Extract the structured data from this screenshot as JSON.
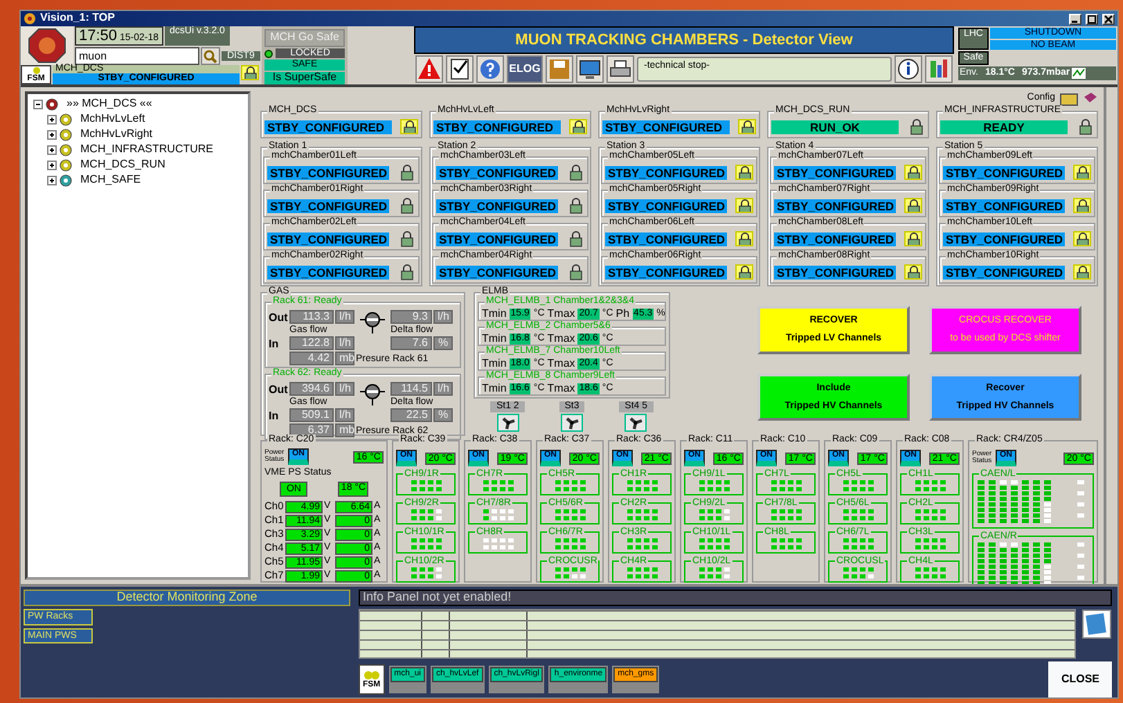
{
  "window": {
    "title": "Vision_1: TOP"
  },
  "header": {
    "clock": "17:50",
    "date": "15-02-18",
    "version": "dcsUi v.3.2.0",
    "search": "muon",
    "dist": "DIST9",
    "fsm": "FSM",
    "node": "MCH_DCS",
    "node_state": "STBY_CONFIGURED"
  },
  "safety": {
    "go_safe": "MCH Go Safe",
    "locked": "LOCKED",
    "safe": "SAFE",
    "supersafe": "Is SuperSafe"
  },
  "title": "MUON TRACKING CHAMBERS - Detector View",
  "toolbar": {
    "elog": "ELOG",
    "message": "-technical stop-"
  },
  "lhc": {
    "label": "LHC",
    "states": [
      "SHUTDOWN",
      "NO BEAM"
    ],
    "safe": "Safe",
    "env": "Env.",
    "temperature": "18.1°C",
    "pressure": "973.7mbar"
  },
  "tree": {
    "label": "»» MCH_DCS ««",
    "expanded": true,
    "children": [
      {
        "label": "MchHvLvLeft",
        "kind": "node",
        "expanded": false
      },
      {
        "label": "MchHvLvRight",
        "kind": "node",
        "expanded": false
      },
      {
        "label": "MCH_INFRASTRUCTURE",
        "kind": "node",
        "expanded": false
      },
      {
        "label": "MCH_DCS_RUN",
        "kind": "node",
        "expanded": false
      },
      {
        "label": "MCH_SAFE",
        "kind": "safe",
        "expanded": false
      }
    ]
  },
  "config": "Config",
  "top_nodes": [
    {
      "label": "MCH_DCS",
      "state": "STBY_CONFIGURED",
      "kind": "standby",
      "lock_highlighted": true
    },
    {
      "label": "MchHvLvLeft",
      "state": "STBY_CONFIGURED",
      "kind": "standby",
      "lock_highlighted": true
    },
    {
      "label": "MchHvLvRight",
      "state": "STBY_CONFIGURED",
      "kind": "standby",
      "lock_highlighted": true
    },
    {
      "label": "MCH_DCS_RUN",
      "state": "RUN_OK",
      "kind": "ok",
      "lock_highlighted": false
    },
    {
      "label": "MCH_INFRASTRUCTURE",
      "state": "READY",
      "kind": "ok",
      "lock_highlighted": false
    }
  ],
  "stations": [
    {
      "title": "Station 1",
      "chambers": [
        {
          "name": "mchChamber01Left",
          "state": "STBY_CONFIGURED",
          "lock_highlighted": false
        },
        {
          "name": "mchChamber01Right",
          "state": "STBY_CONFIGURED",
          "lock_highlighted": false
        },
        {
          "name": "mchChamber02Left",
          "state": "STBY_CONFIGURED",
          "lock_highlighted": false
        },
        {
          "name": "mchChamber02Right",
          "state": "STBY_CONFIGURED",
          "lock_highlighted": false
        }
      ]
    },
    {
      "title": "Station 2",
      "chambers": [
        {
          "name": "mchChamber03Left",
          "state": "STBY_CONFIGURED",
          "lock_highlighted": false
        },
        {
          "name": "mchChamber03Right",
          "state": "STBY_CONFIGURED",
          "lock_highlighted": false
        },
        {
          "name": "mchChamber04Left",
          "state": "STBY_CONFIGURED",
          "lock_highlighted": false
        },
        {
          "name": "mchChamber04Right",
          "state": "STBY_CONFIGURED",
          "lock_highlighted": false
        }
      ]
    },
    {
      "title": "Station 3",
      "chambers": [
        {
          "name": "mchChamber05Left",
          "state": "STBY_CONFIGURED",
          "lock_highlighted": true
        },
        {
          "name": "mchChamber05Right",
          "state": "STBY_CONFIGURED",
          "lock_highlighted": true
        },
        {
          "name": "mchChamber06Left",
          "state": "STBY_CONFIGURED",
          "lock_highlighted": true
        },
        {
          "name": "mchChamber06Right",
          "state": "STBY_CONFIGURED",
          "lock_highlighted": true
        }
      ]
    },
    {
      "title": "Station 4",
      "chambers": [
        {
          "name": "mchChamber07Left",
          "state": "STBY_CONFIGURED",
          "lock_highlighted": true
        },
        {
          "name": "mchChamber07Right",
          "state": "STBY_CONFIGURED",
          "lock_highlighted": true
        },
        {
          "name": "mchChamber08Left",
          "state": "STBY_CONFIGURED",
          "lock_highlighted": true
        },
        {
          "name": "mchChamber08Right",
          "state": "STBY_CONFIGURED",
          "lock_highlighted": true
        }
      ]
    },
    {
      "title": "Station 5",
      "chambers": [
        {
          "name": "mchChamber09Left",
          "state": "STBY_CONFIGURED",
          "lock_highlighted": true
        },
        {
          "name": "mchChamber09Right",
          "state": "STBY_CONFIGURED",
          "lock_highlighted": true
        },
        {
          "name": "mchChamber10Left",
          "state": "STBY_CONFIGURED",
          "lock_highlighted": true
        },
        {
          "name": "mchChamber10Right",
          "state": "STBY_CONFIGURED",
          "lock_highlighted": true
        }
      ]
    }
  ],
  "gas": {
    "title": "GAS",
    "racks": [
      {
        "status": "Rack 61: Ready",
        "out_label": "Out",
        "in_label": "In",
        "gas_flow_label": "Gas flow",
        "delta_flow_label": "Delta flow",
        "pressure_label": "Presure Rack 61",
        "readings": [
          {
            "value": "113.3",
            "unit": "l/h"
          },
          {
            "value": "9.3",
            "unit": "l/h"
          },
          {
            "value": "122.8",
            "unit": "l/h"
          },
          {
            "value": "7.6",
            "unit": "%"
          },
          {
            "value": "4.42",
            "unit": "mb"
          }
        ]
      },
      {
        "status": "Rack 62: Ready",
        "out_label": "Out",
        "in_label": "In",
        "gas_flow_label": "Gas flow",
        "delta_flow_label": "Delta flow",
        "pressure_label": "Presure Rack 62",
        "readings": [
          {
            "value": "394.6",
            "unit": "l/h"
          },
          {
            "value": "114.5",
            "unit": "l/h"
          },
          {
            "value": "509.1",
            "unit": "l/h"
          },
          {
            "value": "22.5",
            "unit": "%"
          },
          {
            "value": "6.37",
            "unit": "mb"
          }
        ]
      }
    ]
  },
  "elmb": {
    "title": "ELMB",
    "items": [
      {
        "name": "MCH_ELMB_1 Chamber1&2&3&4",
        "cells": [
          {
            "label": "Tmin",
            "value": "15.9",
            "unit": "°C"
          },
          {
            "label": "Tmax",
            "value": "20.7",
            "unit": "°C"
          },
          {
            "label": "Ph",
            "value": "45.3",
            "unit": "%"
          }
        ]
      },
      {
        "name": "MCH_ELMB_2 Chamber5&6",
        "cells": [
          {
            "label": "Tmin",
            "value": "16.8",
            "unit": "°C"
          },
          {
            "label": "Tmax",
            "value": "20.6",
            "unit": "°C"
          }
        ]
      },
      {
        "name": "MCH_ELMB_7 Chamber10Left",
        "cells": [
          {
            "label": "Tmin",
            "value": "18.0",
            "unit": "°C"
          },
          {
            "label": "Tmax",
            "value": "20.4",
            "unit": "°C"
          }
        ]
      },
      {
        "name": "MCH_ELMB_8 Chamber9Left",
        "cells": [
          {
            "label": "Tmin",
            "value": "16.6",
            "unit": "°C"
          },
          {
            "label": "Tmax",
            "value": "18.6",
            "unit": "°C"
          }
        ]
      }
    ]
  },
  "fans": [
    {
      "label": "St1 2"
    },
    {
      "label": "St3"
    },
    {
      "label": "St4 5"
    }
  ],
  "actions": [
    {
      "line1": "RECOVER",
      "line2": "Tripped LV Channels",
      "color": "#ffff00"
    },
    {
      "line1": "CROCUS RECOVER",
      "line2": "to be used by DCS shifter",
      "color": "#ff00ff"
    },
    {
      "line1": "Include",
      "line2": "Tripped HV Channels",
      "color": "#00ee00"
    },
    {
      "line1": "Recover",
      "line2": "Tripped HV Channels",
      "color": "#3399ff"
    }
  ],
  "c20": {
    "title": "Rack: C20",
    "power_label": "Power Status",
    "power": "ON",
    "temp": "16 °C",
    "vme_label": "VME PS Status",
    "vme": "ON",
    "vme_temp": "18 °C",
    "channels": [
      {
        "name": "Ch0",
        "volt": "4.99",
        "volt_unit": "V",
        "amp": "6.64",
        "amp_unit": "A"
      },
      {
        "name": "Ch1",
        "volt": "11.94",
        "volt_unit": "V",
        "amp": "0",
        "amp_unit": "A"
      },
      {
        "name": "Ch3",
        "volt": "3.29",
        "volt_unit": "V",
        "amp": "0",
        "amp_unit": "A"
      },
      {
        "name": "Ch4",
        "volt": "5.17",
        "volt_unit": "V",
        "amp": "0",
        "amp_unit": "A"
      },
      {
        "name": "Ch5",
        "volt": "11.95",
        "volt_unit": "V",
        "amp": "0",
        "amp_unit": "A"
      },
      {
        "name": "Ch7",
        "volt": "1.99",
        "volt_unit": "V",
        "amp": "0",
        "amp_unit": "A"
      }
    ]
  },
  "racks": [
    {
      "title": "Rack: C39",
      "kind": "crates",
      "power": "ON",
      "temp": "20 °C",
      "groups": [
        {
          "label": "CH9/1R",
          "leds": [
            true,
            true,
            true,
            true,
            true,
            true,
            true,
            true
          ]
        },
        {
          "label": "CH9/2R",
          "leds": [
            true,
            true,
            true,
            false,
            true,
            true,
            true,
            false
          ]
        },
        {
          "label": "CH10/1R",
          "leds": [
            true,
            true,
            true,
            true,
            true,
            true,
            true,
            true
          ]
        },
        {
          "label": "CH10/2R",
          "leds": [
            true,
            true,
            true,
            false,
            true,
            true,
            true,
            false
          ]
        }
      ]
    },
    {
      "title": "Rack: C38",
      "kind": "crates",
      "power": "ON",
      "temp": "19 °C",
      "groups": [
        {
          "label": "CH7R",
          "leds": [
            true,
            true,
            true,
            true,
            true,
            true,
            true,
            true
          ]
        },
        {
          "label": "CH7/8R",
          "leds": [
            true,
            false,
            false,
            false,
            true,
            false,
            false,
            false
          ]
        },
        {
          "label": "CH8R",
          "leds": [
            false,
            false,
            false,
            false,
            false,
            false,
            false,
            false
          ]
        }
      ]
    },
    {
      "title": "Rack: C37",
      "kind": "crates",
      "power": "ON",
      "temp": "20 °C",
      "groups": [
        {
          "label": "CH5R",
          "leds": [
            true,
            true,
            true,
            true,
            true,
            true,
            true,
            true
          ]
        },
        {
          "label": "CH5/6R",
          "leds": [
            true,
            true,
            true,
            true,
            true,
            true,
            true,
            true
          ]
        },
        {
          "label": "CH6/7R",
          "leds": [
            true,
            true,
            true,
            true,
            true,
            true,
            true,
            true
          ]
        },
        {
          "label": "CROCUSR",
          "leds": [
            true,
            true,
            true,
            true,
            true,
            true,
            false,
            false
          ]
        }
      ]
    },
    {
      "title": "Rack: C36",
      "kind": "crates",
      "power": "ON",
      "temp": "21 °C",
      "groups": [
        {
          "label": "CH1R",
          "leds": [
            true,
            true,
            true,
            true,
            true,
            true,
            true,
            true
          ]
        },
        {
          "label": "CH2R",
          "leds": [
            true,
            true,
            true,
            true,
            true,
            true,
            true,
            true
          ]
        },
        {
          "label": "CH3R",
          "leds": [
            true,
            true,
            true,
            true,
            true,
            true,
            true,
            true
          ]
        },
        {
          "label": "CH4R",
          "leds": [
            true,
            true,
            true,
            true,
            true,
            true,
            true,
            true
          ]
        }
      ]
    },
    {
      "title": "Rack: C11",
      "kind": "crates",
      "power": "ON",
      "temp": "16 °C",
      "groups": [
        {
          "label": "CH9/1L",
          "leds": [
            true,
            true,
            true,
            true,
            true,
            true,
            true,
            true
          ]
        },
        {
          "label": "CH9/2L",
          "leds": [
            true,
            true,
            true,
            false,
            true,
            true,
            true,
            false
          ]
        },
        {
          "label": "CH10/1L",
          "leds": [
            true,
            true,
            true,
            true,
            true,
            true,
            true,
            true
          ]
        },
        {
          "label": "CH10/2L",
          "leds": [
            true,
            true,
            true,
            false,
            true,
            true,
            true,
            false
          ]
        }
      ]
    },
    {
      "title": "Rack: C10",
      "kind": "crates",
      "power": "ON",
      "temp": "17 °C",
      "groups": [
        {
          "label": "CH7L",
          "leds": [
            true,
            true,
            true,
            true,
            true,
            true,
            true,
            true
          ]
        },
        {
          "label": "CH7/8L",
          "leds": [
            true,
            true,
            true,
            true,
            true,
            true,
            true,
            true
          ]
        },
        {
          "label": "CH8L",
          "leds": [
            true,
            true,
            true,
            true,
            true,
            true,
            true,
            true
          ]
        }
      ]
    },
    {
      "title": "Rack: C09",
      "kind": "crates",
      "power": "ON",
      "temp": "17 °C",
      "groups": [
        {
          "label": "CH5L",
          "leds": [
            true,
            true,
            true,
            true,
            true,
            true,
            true,
            true
          ]
        },
        {
          "label": "CH5/6L",
          "leds": [
            true,
            true,
            true,
            true,
            true,
            true,
            true,
            true
          ]
        },
        {
          "label": "CH6/7L",
          "leds": [
            true,
            true,
            true,
            true,
            true,
            true,
            true,
            true
          ]
        },
        {
          "label": "CROCUSL",
          "leds": [
            true,
            true,
            true,
            true,
            true,
            true,
            true,
            false
          ]
        }
      ]
    },
    {
      "title": "Rack: C08",
      "kind": "crates",
      "power": "ON",
      "temp": "21 °C",
      "groups": [
        {
          "label": "CH1L",
          "leds": [
            true,
            true,
            true,
            true,
            true,
            true,
            true,
            true
          ]
        },
        {
          "label": "CH2L",
          "leds": [
            true,
            true,
            true,
            true,
            true,
            true,
            true,
            true
          ]
        },
        {
          "label": "CH3L",
          "leds": [
            true,
            true,
            true,
            true,
            true,
            true,
            true,
            true
          ]
        },
        {
          "label": "CH4L",
          "leds": [
            true,
            true,
            true,
            true,
            true,
            true,
            true,
            true
          ]
        }
      ]
    },
    {
      "title": "Rack: CR4/Z05",
      "kind": "caen",
      "power_label": "Power Status",
      "power": "ON",
      "temp": "20 °C",
      "groups": [
        {
          "label": "CAEN/L"
        },
        {
          "label": "CAEN/R"
        }
      ]
    }
  ],
  "bottom": {
    "zone": "Detector Monitoring Zone",
    "zone_buttons": [
      "PW Racks",
      "MAIN PWS"
    ],
    "info": "Info Panel not yet enabled!",
    "fsm": "FSM",
    "tasks": [
      {
        "label": "mch_ui",
        "color": "#00c896"
      },
      {
        "label": "ch_hvLvLef",
        "color": "#00c896"
      },
      {
        "label": "ch_hvLvRigl",
        "color": "#00c896"
      },
      {
        "label": "h_environme",
        "color": "#00c896"
      },
      {
        "label": "mch_gms",
        "color": "#ff9900"
      }
    ],
    "close": "CLOSE"
  }
}
